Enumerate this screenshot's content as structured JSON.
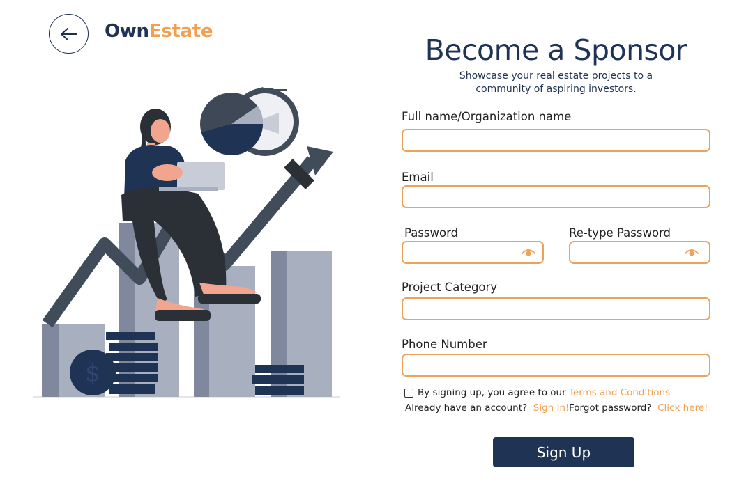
{
  "brand": {
    "part1": "Own",
    "part2": "Estate"
  },
  "header": {
    "back_icon": "arrow-left-icon"
  },
  "form": {
    "title": "Become a Sponsor",
    "subtitle_line1": "Showcase your real estate projects to a",
    "subtitle_line2": "community of aspiring investors.",
    "fields": {
      "full_name": {
        "label": "Full name/Organization name",
        "value": ""
      },
      "email": {
        "label": "Email",
        "value": ""
      },
      "password": {
        "label": "Password",
        "value": "",
        "icon": "eye-icon"
      },
      "retype_password": {
        "label": "Re-type Password",
        "value": "",
        "icon": "eye-icon"
      },
      "project_category": {
        "label": "Project Category",
        "value": ""
      },
      "phone": {
        "label": "Phone Number",
        "value": ""
      }
    },
    "terms": {
      "checked": false,
      "text": "By signing up, you agree to our ",
      "link": "Terms and Conditions"
    },
    "account": {
      "text": "Already have an account? ",
      "link": "Sign In!"
    },
    "forgot": {
      "text": "Forgot password? ",
      "link": "Click here!"
    },
    "submit_label": "Sign Up"
  },
  "colors": {
    "navy": "#1f3354",
    "accent": "#f0a050",
    "input_border": "#eca15c"
  }
}
